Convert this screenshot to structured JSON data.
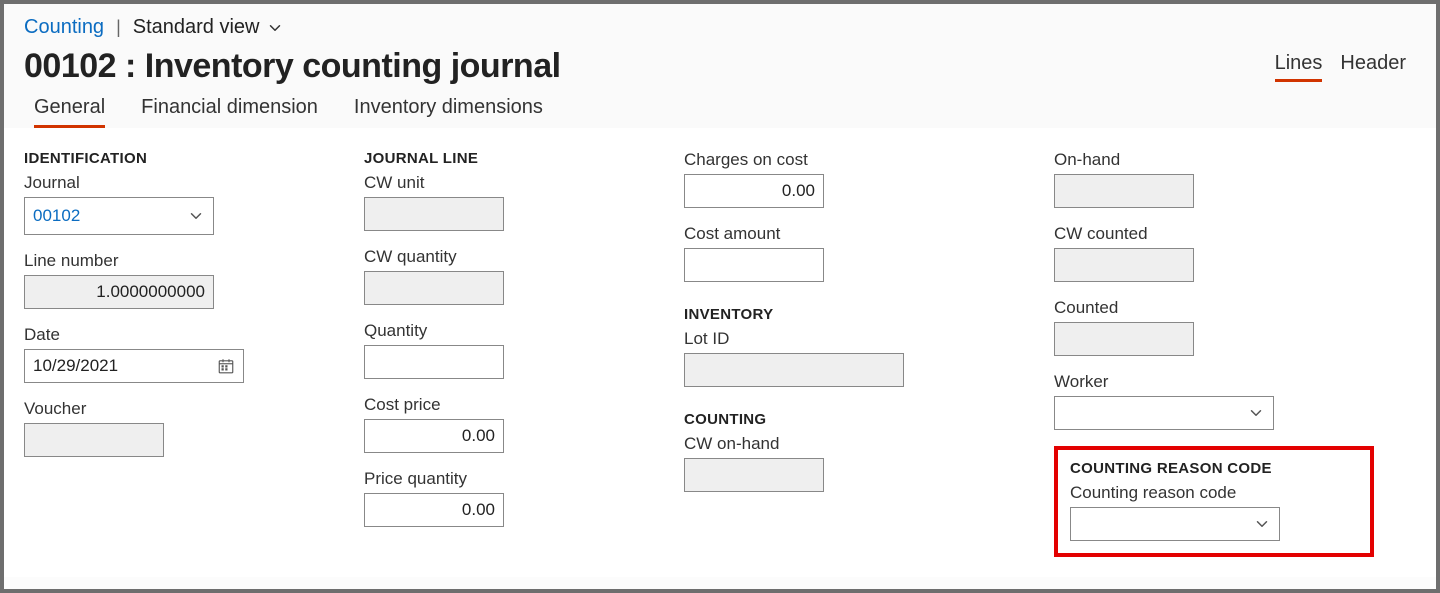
{
  "breadcrumb": {
    "nav": "Counting",
    "view": "Standard view"
  },
  "title": "00102 : Inventory counting journal",
  "view_tabs": {
    "lines": "Lines",
    "header": "Header"
  },
  "subtabs": {
    "general": "General",
    "findim": "Financial dimension",
    "invdim": "Inventory dimensions"
  },
  "identification": {
    "head": "IDENTIFICATION",
    "journal_label": "Journal",
    "journal_value": "00102",
    "line_number_label": "Line number",
    "line_number_value": "1.0000000000",
    "date_label": "Date",
    "date_value": "10/29/2021",
    "voucher_label": "Voucher",
    "voucher_value": ""
  },
  "journal_line": {
    "head": "JOURNAL LINE",
    "cw_unit_label": "CW unit",
    "cw_unit_value": "",
    "cw_quantity_label": "CW quantity",
    "cw_quantity_value": "",
    "quantity_label": "Quantity",
    "quantity_value": "",
    "cost_price_label": "Cost price",
    "cost_price_value": "0.00",
    "price_quantity_label": "Price quantity",
    "price_quantity_value": "0.00"
  },
  "charges": {
    "charges_on_cost_label": "Charges on cost",
    "charges_on_cost_value": "0.00",
    "cost_amount_label": "Cost amount",
    "cost_amount_value": ""
  },
  "inventory": {
    "head": "INVENTORY",
    "lot_id_label": "Lot ID",
    "lot_id_value": ""
  },
  "counting": {
    "head": "COUNTING",
    "cw_onhand_label": "CW on-hand",
    "cw_onhand_value": ""
  },
  "onhand_group": {
    "onhand_label": "On-hand",
    "onhand_value": "",
    "cw_counted_label": "CW counted",
    "cw_counted_value": "",
    "counted_label": "Counted",
    "counted_value": "",
    "worker_label": "Worker",
    "worker_value": ""
  },
  "reason": {
    "head": "COUNTING REASON CODE",
    "label": "Counting reason code",
    "value": ""
  }
}
